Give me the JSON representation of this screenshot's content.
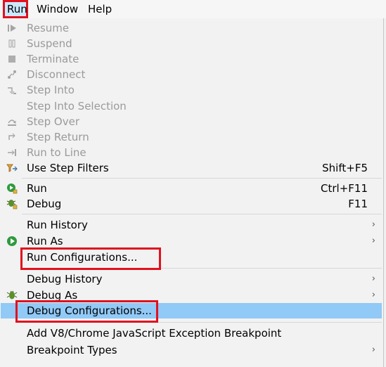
{
  "menubar": {
    "run": "Run",
    "window": "Window",
    "help": "Help"
  },
  "menu": {
    "resume": "Resume",
    "suspend": "Suspend",
    "terminate": "Terminate",
    "disconnect": "Disconnect",
    "step_into": "Step Into",
    "step_into_selection": "Step Into Selection",
    "step_over": "Step Over",
    "step_return": "Step Return",
    "run_to_line": "Run to Line",
    "use_step_filters": "Use Step Filters",
    "use_step_filters_accel": "Shift+F5",
    "run": "Run",
    "run_accel": "Ctrl+F11",
    "debug": "Debug",
    "debug_accel": "F11",
    "run_history": "Run History",
    "run_as": "Run As",
    "run_configurations": "Run Configurations...",
    "debug_history": "Debug History",
    "debug_as": "Debug As",
    "debug_configurations": "Debug Configurations...",
    "add_v8_breakpoint": "Add V8/Chrome JavaScript Exception Breakpoint",
    "breakpoint_types": "Breakpoint Types",
    "submenu_arrow": "›"
  },
  "colors": {
    "highlight": "#91c9f7",
    "annotation_red": "#e0121e",
    "disabled_text": "#9a9a9a"
  },
  "icons": [
    "resume-icon",
    "suspend-icon",
    "terminate-icon",
    "disconnect-icon",
    "step-into-icon",
    "step-over-icon",
    "step-return-icon",
    "run-to-line-icon",
    "step-filters-icon",
    "run-icon",
    "debug-icon",
    "run-as-icon",
    "debug-as-icon"
  ]
}
